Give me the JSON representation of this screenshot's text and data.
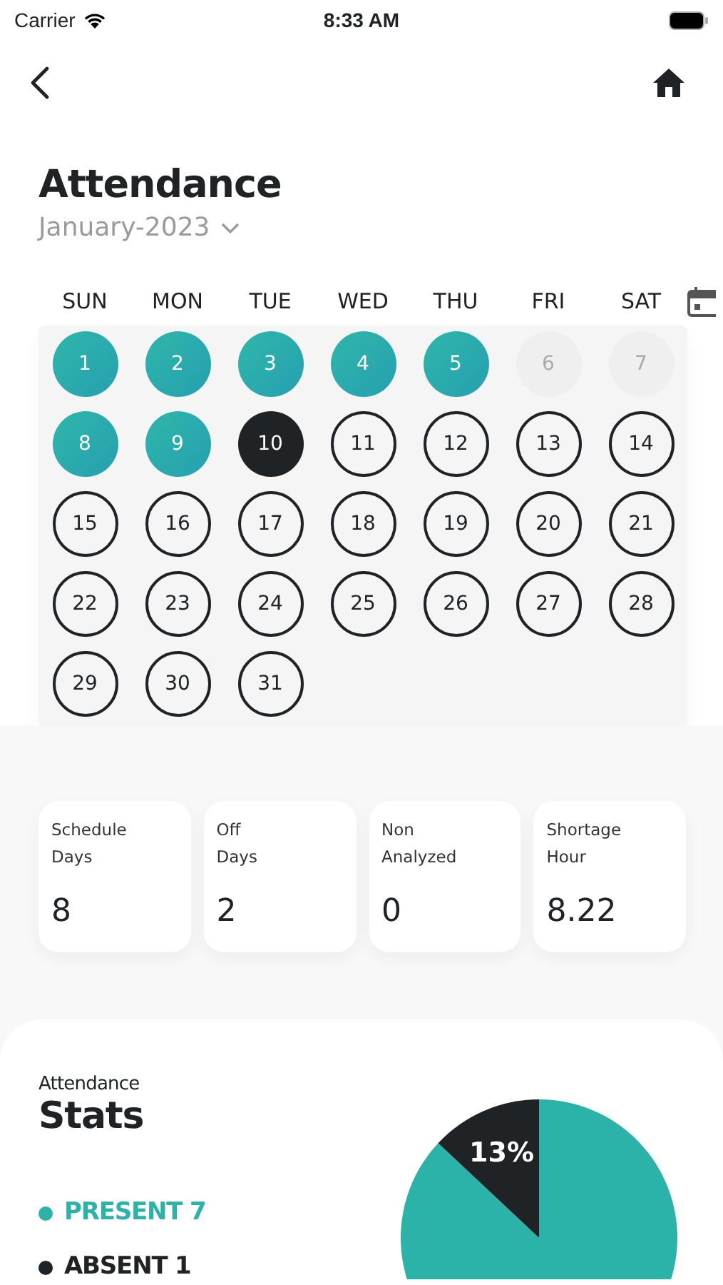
{
  "status_bar": {
    "carrier": "Carrier",
    "time": "8:33 AM"
  },
  "header": {
    "title": "Attendance",
    "month": "January-2023"
  },
  "calendar": {
    "weekdays": [
      "SUN",
      "MON",
      "TUE",
      "WED",
      "THU",
      "FRI",
      "SAT"
    ],
    "days": [
      {
        "label": "1",
        "kind": "present"
      },
      {
        "label": "2",
        "kind": "present"
      },
      {
        "label": "3",
        "kind": "present"
      },
      {
        "label": "4",
        "kind": "present"
      },
      {
        "label": "5",
        "kind": "present"
      },
      {
        "label": "6",
        "kind": "off"
      },
      {
        "label": "7",
        "kind": "off"
      },
      {
        "label": "8",
        "kind": "present"
      },
      {
        "label": "9",
        "kind": "present"
      },
      {
        "label": "10",
        "kind": "absent"
      },
      {
        "label": "11",
        "kind": "open"
      },
      {
        "label": "12",
        "kind": "open"
      },
      {
        "label": "13",
        "kind": "open"
      },
      {
        "label": "14",
        "kind": "open"
      },
      {
        "label": "15",
        "kind": "open"
      },
      {
        "label": "16",
        "kind": "open"
      },
      {
        "label": "17",
        "kind": "open"
      },
      {
        "label": "18",
        "kind": "open"
      },
      {
        "label": "19",
        "kind": "open"
      },
      {
        "label": "20",
        "kind": "open"
      },
      {
        "label": "21",
        "kind": "open"
      },
      {
        "label": "22",
        "kind": "open"
      },
      {
        "label": "23",
        "kind": "open"
      },
      {
        "label": "24",
        "kind": "open"
      },
      {
        "label": "25",
        "kind": "open"
      },
      {
        "label": "26",
        "kind": "open"
      },
      {
        "label": "27",
        "kind": "open"
      },
      {
        "label": "28",
        "kind": "open"
      },
      {
        "label": "29",
        "kind": "open"
      },
      {
        "label": "30",
        "kind": "open"
      },
      {
        "label": "31",
        "kind": "open"
      }
    ]
  },
  "summary": [
    {
      "label": "Schedule Days",
      "value": "8"
    },
    {
      "label": "Off Days",
      "value": "2"
    },
    {
      "label": "Non Analyzed",
      "value": "0"
    },
    {
      "label": "Shortage Hour",
      "value": "8.22"
    }
  ],
  "stats": {
    "caption": "Attendance",
    "title": "Stats",
    "legend": [
      {
        "label": "PRESENT 7",
        "color": "#2bb3a9"
      },
      {
        "label": "ABSENT 1",
        "color": "#202326"
      }
    ],
    "chart_data": {
      "type": "pie",
      "values": [
        87,
        13
      ],
      "annotations": [
        "13%"
      ]
    }
  }
}
